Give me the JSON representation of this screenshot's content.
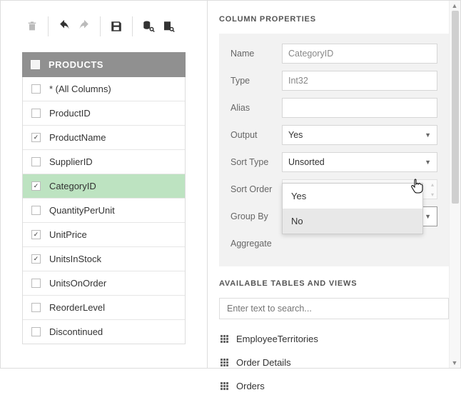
{
  "toolbar": {
    "icons": [
      "trash",
      "undo",
      "redo",
      "save",
      "db-search",
      "query-search"
    ]
  },
  "table": {
    "name": "PRODUCTS",
    "columns": [
      {
        "label": "* (All Columns)",
        "checked": false,
        "selected": false
      },
      {
        "label": "ProductID",
        "checked": false,
        "selected": false
      },
      {
        "label": "ProductName",
        "checked": true,
        "selected": false
      },
      {
        "label": "SupplierID",
        "checked": false,
        "selected": false
      },
      {
        "label": "CategoryID",
        "checked": true,
        "selected": true
      },
      {
        "label": "QuantityPerUnit",
        "checked": false,
        "selected": false
      },
      {
        "label": "UnitPrice",
        "checked": true,
        "selected": false
      },
      {
        "label": "UnitsInStock",
        "checked": true,
        "selected": false
      },
      {
        "label": "UnitsOnOrder",
        "checked": false,
        "selected": false
      },
      {
        "label": "ReorderLevel",
        "checked": false,
        "selected": false
      },
      {
        "label": "Discontinued",
        "checked": false,
        "selected": false
      }
    ]
  },
  "properties": {
    "title": "COLUMN PROPERTIES",
    "rows": {
      "name_label": "Name",
      "name_value": "CategoryID",
      "type_label": "Type",
      "type_value": "Int32",
      "alias_label": "Alias",
      "alias_value": "",
      "output_label": "Output",
      "output_value": "Yes",
      "sorttype_label": "Sort Type",
      "sorttype_value": "Unsorted",
      "sortorder_label": "Sort Order",
      "sortorder_value": "",
      "groupby_label": "Group By",
      "groupby_value": "No",
      "aggregate_label": "Aggregate",
      "aggregate_value": ""
    },
    "groupby_options": [
      "Yes",
      "No"
    ],
    "groupby_highlight": "No"
  },
  "available": {
    "title": "AVAILABLE TABLES AND VIEWS",
    "search_placeholder": "Enter text to search...",
    "items": [
      "EmployeeTerritories",
      "Order Details",
      "Orders"
    ]
  }
}
